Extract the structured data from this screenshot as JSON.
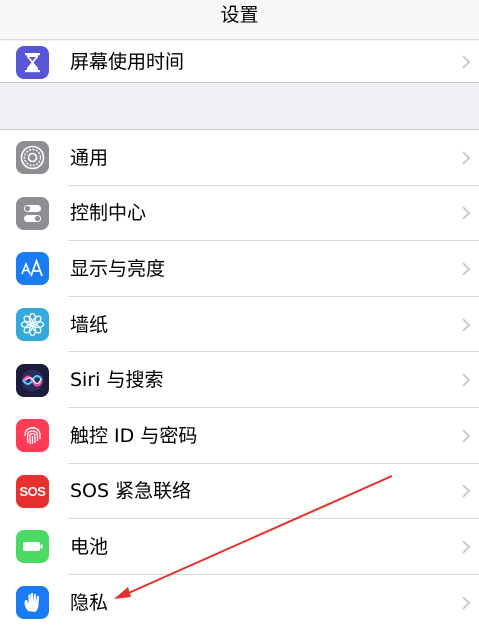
{
  "header": {
    "title": "设置"
  },
  "rows_top": [
    {
      "label": "屏幕使用时间",
      "icon": "hourglass-icon",
      "color": "#5856d6"
    }
  ],
  "rows": [
    {
      "label": "通用",
      "icon": "gear-icon",
      "color": "#8e8e93"
    },
    {
      "label": "控制中心",
      "icon": "toggles-icon",
      "color": "#8e8e93"
    },
    {
      "label": "显示与亮度",
      "icon": "text-size-icon",
      "color": "#1a7cf5"
    },
    {
      "label": "墙纸",
      "icon": "flower-icon",
      "color": "#34aadc"
    },
    {
      "label": "Siri 与搜索",
      "icon": "siri-icon",
      "color": "#1c1c3c"
    },
    {
      "label": "触控 ID 与密码",
      "icon": "fingerprint-icon",
      "color": "#ff3b55"
    },
    {
      "label": "SOS 紧急联络",
      "icon_text": "SOS",
      "icon": "sos-icon",
      "color": "#e5302f"
    },
    {
      "label": "电池",
      "icon": "battery-icon",
      "color": "#4cd964"
    },
    {
      "label": "隐私",
      "icon": "hand-icon",
      "color": "#1a7cf5"
    }
  ],
  "annotation": {
    "color": "#e8302a"
  }
}
